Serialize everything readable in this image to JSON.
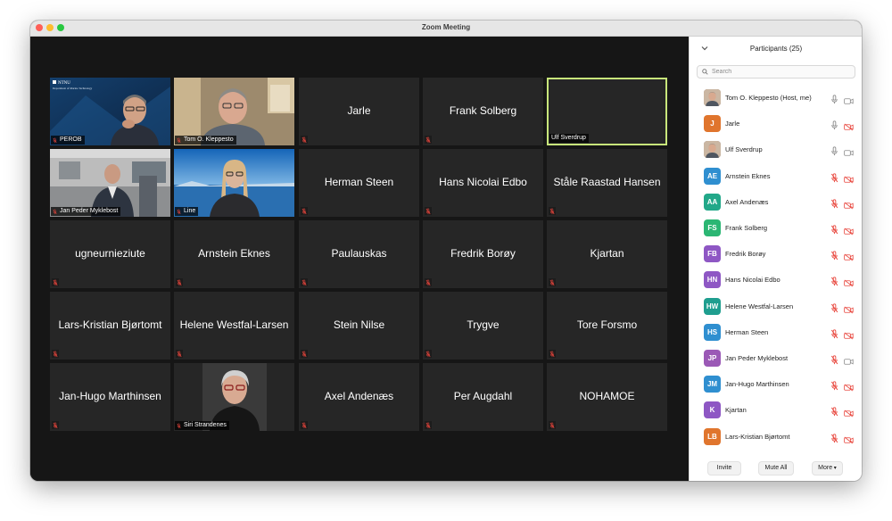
{
  "window": {
    "title": "Zoom Meeting"
  },
  "gallery": {
    "tiles": [
      {
        "name": "PEROB",
        "type": "video",
        "scene": "ntnu"
      },
      {
        "name": "Tom O. Kleppesto",
        "type": "video",
        "scene": "man-office"
      },
      {
        "name": "Jarle",
        "type": "name"
      },
      {
        "name": "Frank Solberg",
        "type": "name"
      },
      {
        "name": "Ulf Sverdrup",
        "type": "active"
      },
      {
        "name": "Jan Peder Myklebost",
        "type": "video",
        "scene": "office"
      },
      {
        "name": "Line",
        "type": "video",
        "scene": "sea"
      },
      {
        "name": "Herman Steen",
        "type": "name"
      },
      {
        "name": "Hans Nicolai Edbo",
        "type": "name"
      },
      {
        "name": "Ståle Raastad Hansen",
        "type": "name"
      },
      {
        "name": "ugneurnieziute",
        "type": "name"
      },
      {
        "name": "Arnstein Eknes",
        "type": "name"
      },
      {
        "name": "Paulauskas",
        "type": "name"
      },
      {
        "name": "Fredrik Borøy",
        "type": "name"
      },
      {
        "name": "Kjartan",
        "type": "name"
      },
      {
        "name": "Lars-Kristian Bjørtomt",
        "type": "name"
      },
      {
        "name": "Helene Westfal-Larsen",
        "type": "name"
      },
      {
        "name": "Stein Nilse",
        "type": "name"
      },
      {
        "name": "Trygve",
        "type": "name"
      },
      {
        "name": "Tore Forsmo",
        "type": "name"
      },
      {
        "name": "Jan-Hugo Marthinsen",
        "type": "name"
      },
      {
        "name": "Siri Strandenes",
        "type": "video",
        "scene": "portrait"
      },
      {
        "name": "Axel Andenæs",
        "type": "name"
      },
      {
        "name": "Per Augdahl",
        "type": "name"
      },
      {
        "name": "NOHAMOE",
        "type": "name"
      }
    ]
  },
  "ntnu_logo": {
    "text": "NTNU",
    "subtitle": "Department of Marine Technology"
  },
  "participants": {
    "title": "Participants (25)",
    "search_placeholder": "Search",
    "items": [
      {
        "name": "Tom O. Kleppesto (Host, me)",
        "initials": "",
        "photo": true,
        "color": "#8a6b55",
        "mic": "on",
        "cam": "on"
      },
      {
        "name": "Jarle",
        "initials": "J",
        "photo": false,
        "color": "#e0752d",
        "mic": "on",
        "cam": "off"
      },
      {
        "name": "Ulf Sverdrup",
        "initials": "",
        "photo": true,
        "color": "#7a6a66",
        "mic": "on",
        "cam": "on"
      },
      {
        "name": "Arnstein Eknes",
        "initials": "AE",
        "photo": false,
        "color": "#2f8fd0",
        "mic": "off",
        "cam": "off"
      },
      {
        "name": "Axel Andenæs",
        "initials": "AA",
        "photo": false,
        "color": "#22a889",
        "mic": "off",
        "cam": "off"
      },
      {
        "name": "Frank Solberg",
        "initials": "FS",
        "photo": false,
        "color": "#2bb673",
        "mic": "off",
        "cam": "off"
      },
      {
        "name": "Fredrik Borøy",
        "initials": "FB",
        "photo": false,
        "color": "#8e57c4",
        "mic": "off",
        "cam": "off"
      },
      {
        "name": "Hans Nicolai Edbo",
        "initials": "HN",
        "photo": false,
        "color": "#8e57c4",
        "mic": "off",
        "cam": "off"
      },
      {
        "name": "Helene Westfal-Larsen",
        "initials": "HW",
        "photo": false,
        "color": "#1f9e8f",
        "mic": "off",
        "cam": "off"
      },
      {
        "name": "Herman Steen",
        "initials": "HS",
        "photo": false,
        "color": "#2f8fd0",
        "mic": "off",
        "cam": "off"
      },
      {
        "name": "Jan Peder Myklebost",
        "initials": "JP",
        "photo": false,
        "color": "#9b59b6",
        "mic": "off",
        "cam": "on"
      },
      {
        "name": "Jan-Hugo Marthinsen",
        "initials": "JM",
        "photo": false,
        "color": "#2f8fd0",
        "mic": "off",
        "cam": "off"
      },
      {
        "name": "Kjartan",
        "initials": "K",
        "photo": false,
        "color": "#8e57c4",
        "mic": "off",
        "cam": "off"
      },
      {
        "name": "Lars-Kristian Bjørtomt",
        "initials": "LB",
        "photo": false,
        "color": "#e0752d",
        "mic": "off",
        "cam": "off"
      }
    ],
    "footer": {
      "invite": "Invite",
      "mute_all": "Mute All",
      "more": "More"
    }
  },
  "colors": {
    "gallery_bg": "#161616",
    "tile_bg": "#262626",
    "active_speaker": "#c8e67b",
    "muted_red": "#e8453c"
  }
}
